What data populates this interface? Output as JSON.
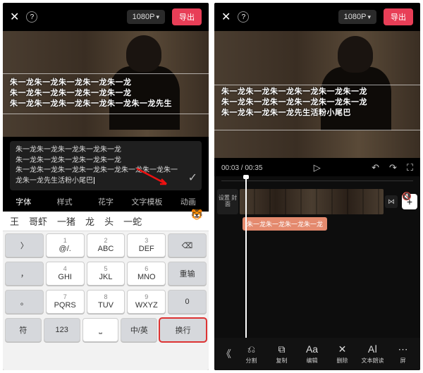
{
  "header": {
    "resolution": "1080P",
    "export": "导出"
  },
  "left": {
    "overlay_lines": [
      "朱一龙朱一龙朱一龙朱一龙朱一龙",
      "朱一龙朱一龙朱一龙朱一龙朱一龙",
      "朱一龙朱一龙朱一龙朱一龙朱一龙朱一龙先生"
    ],
    "edit_lines": [
      "朱一龙朱一龙朱一龙朱一龙朱一龙",
      "朱一龙朱一龙朱一龙朱一龙朱一龙",
      "朱一龙朱一龙朱一龙朱一龙朱一龙朱一龙朱一龙朱一龙朱一龙先生活粉小尾巴"
    ],
    "tabs": [
      "字体",
      "样式",
      "花字",
      "文字模板",
      "动画"
    ],
    "active_tab": 0,
    "suggestions": [
      "王",
      "哥虾",
      "一猪",
      "龙",
      "头",
      "一蛇"
    ],
    "keys": {
      "r1": [
        {
          "n": "1",
          "l": "@/."
        },
        {
          "n": "2",
          "l": "ABC"
        },
        {
          "n": "3",
          "l": "DEF"
        }
      ],
      "r2": [
        {
          "n": "4",
          "l": "GHI"
        },
        {
          "n": "5",
          "l": "JKL"
        },
        {
          "n": "6",
          "l": "MNO"
        }
      ],
      "r3": [
        {
          "n": "7",
          "l": "PQRS"
        },
        {
          "n": "8",
          "l": "TUV"
        },
        {
          "n": "9",
          "l": "WXYZ"
        }
      ],
      "side": {
        "back": "⌫",
        "reinput": "重输",
        "zero": "0"
      },
      "bottom": {
        "sym": "符",
        "toggle": "中/英",
        "mid": "123",
        "newline": "换行"
      }
    }
  },
  "right": {
    "overlay_lines": [
      "朱一龙朱一龙朱一龙朱一龙朱一龙朱一龙",
      "朱一龙朱一龙朱一龙朱一龙朱一龙朱一龙",
      "朱一龙朱一龙朱一龙先生活粉小尾巴"
    ],
    "time": {
      "current": "00:03",
      "total": "00:35"
    },
    "cover_btn": "设置\n封面",
    "subclip_label": "朱一龙朱一龙朱一龙朱一龙",
    "tools": [
      {
        "icon": "⎌",
        "label": "分割"
      },
      {
        "icon": "⧉",
        "label": "复制"
      },
      {
        "icon": "Aa",
        "label": "编辑"
      },
      {
        "icon": "✕",
        "label": "删除"
      },
      {
        "icon": "Aا",
        "label": "文本朗读"
      },
      {
        "icon": "⋯",
        "label": "屏"
      }
    ]
  }
}
